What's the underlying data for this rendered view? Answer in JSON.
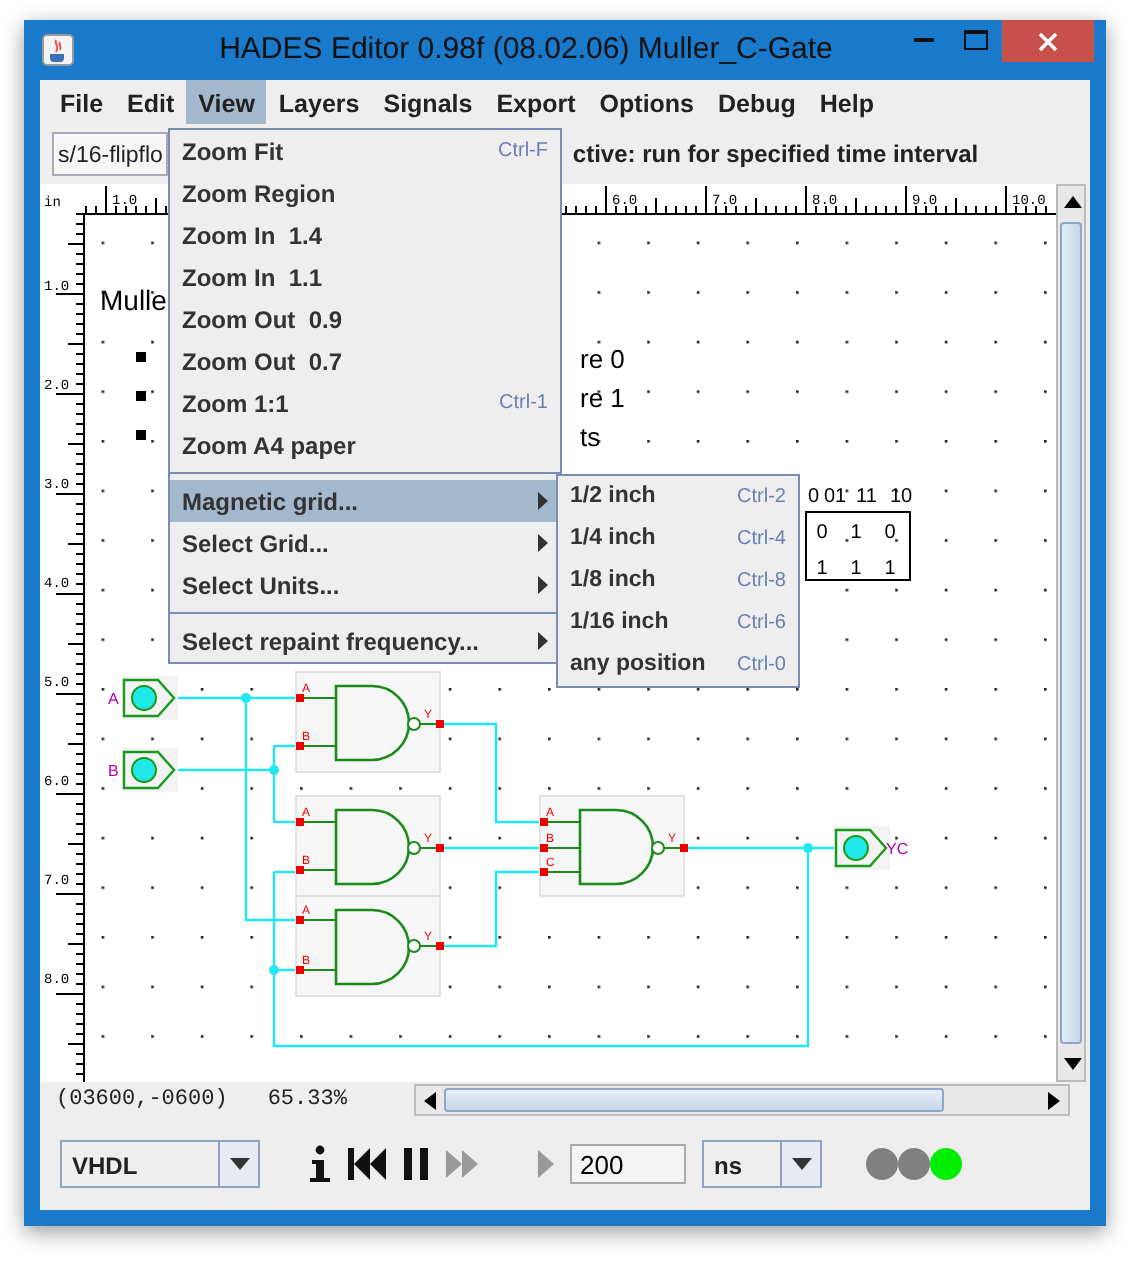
{
  "window": {
    "title": "HADES Editor 0.98f (08.02.06)   Muller_C-Gate"
  },
  "menu_bar": [
    {
      "label": "File",
      "selected": false
    },
    {
      "label": "Edit",
      "selected": false
    },
    {
      "label": "View",
      "selected": true
    },
    {
      "label": "Layers",
      "selected": false
    },
    {
      "label": "Signals",
      "selected": false
    },
    {
      "label": "Export",
      "selected": false
    },
    {
      "label": "Options",
      "selected": false
    },
    {
      "label": "Debug",
      "selected": false
    },
    {
      "label": "Help",
      "selected": false
    }
  ],
  "view_menu": [
    {
      "kind": "item",
      "label": "Zoom Fit",
      "shortcut": "Ctrl-F",
      "selected": false
    },
    {
      "kind": "item",
      "label": "Zoom Region",
      "selected": false
    },
    {
      "kind": "item",
      "label": "Zoom In  1.4",
      "selected": false
    },
    {
      "kind": "item",
      "label": "Zoom In  1.1",
      "selected": false
    },
    {
      "kind": "item",
      "label": "Zoom Out  0.9",
      "selected": false
    },
    {
      "kind": "item",
      "label": "Zoom Out  0.7",
      "selected": false
    },
    {
      "kind": "item",
      "label": "Zoom 1:1",
      "shortcut": "Ctrl-1",
      "selected": false
    },
    {
      "kind": "item",
      "label": "Zoom A4 paper",
      "selected": false
    },
    {
      "kind": "separator"
    },
    {
      "kind": "submenu",
      "label": "Magnetic grid...",
      "selected": true
    },
    {
      "kind": "submenu",
      "label": "Select Grid...",
      "selected": false
    },
    {
      "kind": "submenu",
      "label": "Select Units...",
      "selected": false
    },
    {
      "kind": "separator"
    },
    {
      "kind": "submenu",
      "label": "Select repaint frequency...",
      "selected": false
    }
  ],
  "submenu": [
    {
      "label": "1/2 inch",
      "shortcut": "Ctrl-2"
    },
    {
      "label": "1/4 inch",
      "shortcut": "Ctrl-4"
    },
    {
      "label": "1/8 inch",
      "shortcut": "Ctrl-8"
    },
    {
      "label": "1/16 inch",
      "shortcut": "Ctrl-6"
    },
    {
      "label": "any position",
      "shortcut": "Ctrl-0"
    }
  ],
  "toolbar": {
    "path_field": "s/16-flipflo",
    "message": "ctive: run for specified time interval"
  },
  "ruler": {
    "unit": "in",
    "x_labels": [
      "1.0",
      "6.0",
      "7.0",
      "8.0",
      "9.0",
      "10.0"
    ],
    "y_labels": [
      "1.0",
      "2.0",
      "3.0",
      "4.0",
      "5.0",
      "6.0",
      "7.0",
      "8.0"
    ]
  },
  "canvas": {
    "title": "Mulle",
    "bullets": [
      "re 0",
      "re 1",
      "ts"
    ],
    "truth_table": [
      [
        "0",
        "01",
        "11",
        "10"
      ],
      [
        "0",
        "1",
        "0"
      ],
      [
        "1",
        "1",
        "1"
      ]
    ],
    "inputs": [
      "A",
      "B"
    ],
    "output": "YC",
    "gates": [
      {
        "pins": [
          "A",
          "B",
          "Y"
        ]
      },
      {
        "pins": [
          "A",
          "B",
          "Y"
        ]
      },
      {
        "pins": [
          "A",
          "B",
          "Y"
        ]
      },
      {
        "pins": [
          "A",
          "B",
          "C",
          "Y"
        ]
      }
    ]
  },
  "status": {
    "coordinates": "(03600,-0600)",
    "zoom": "65.33%"
  },
  "sim_bar": {
    "language": "VHDL",
    "time": "200",
    "unit": "ns",
    "lights": [
      {
        "color": "#808080"
      },
      {
        "color": "#808080"
      },
      {
        "color": "#00ee00"
      }
    ]
  }
}
